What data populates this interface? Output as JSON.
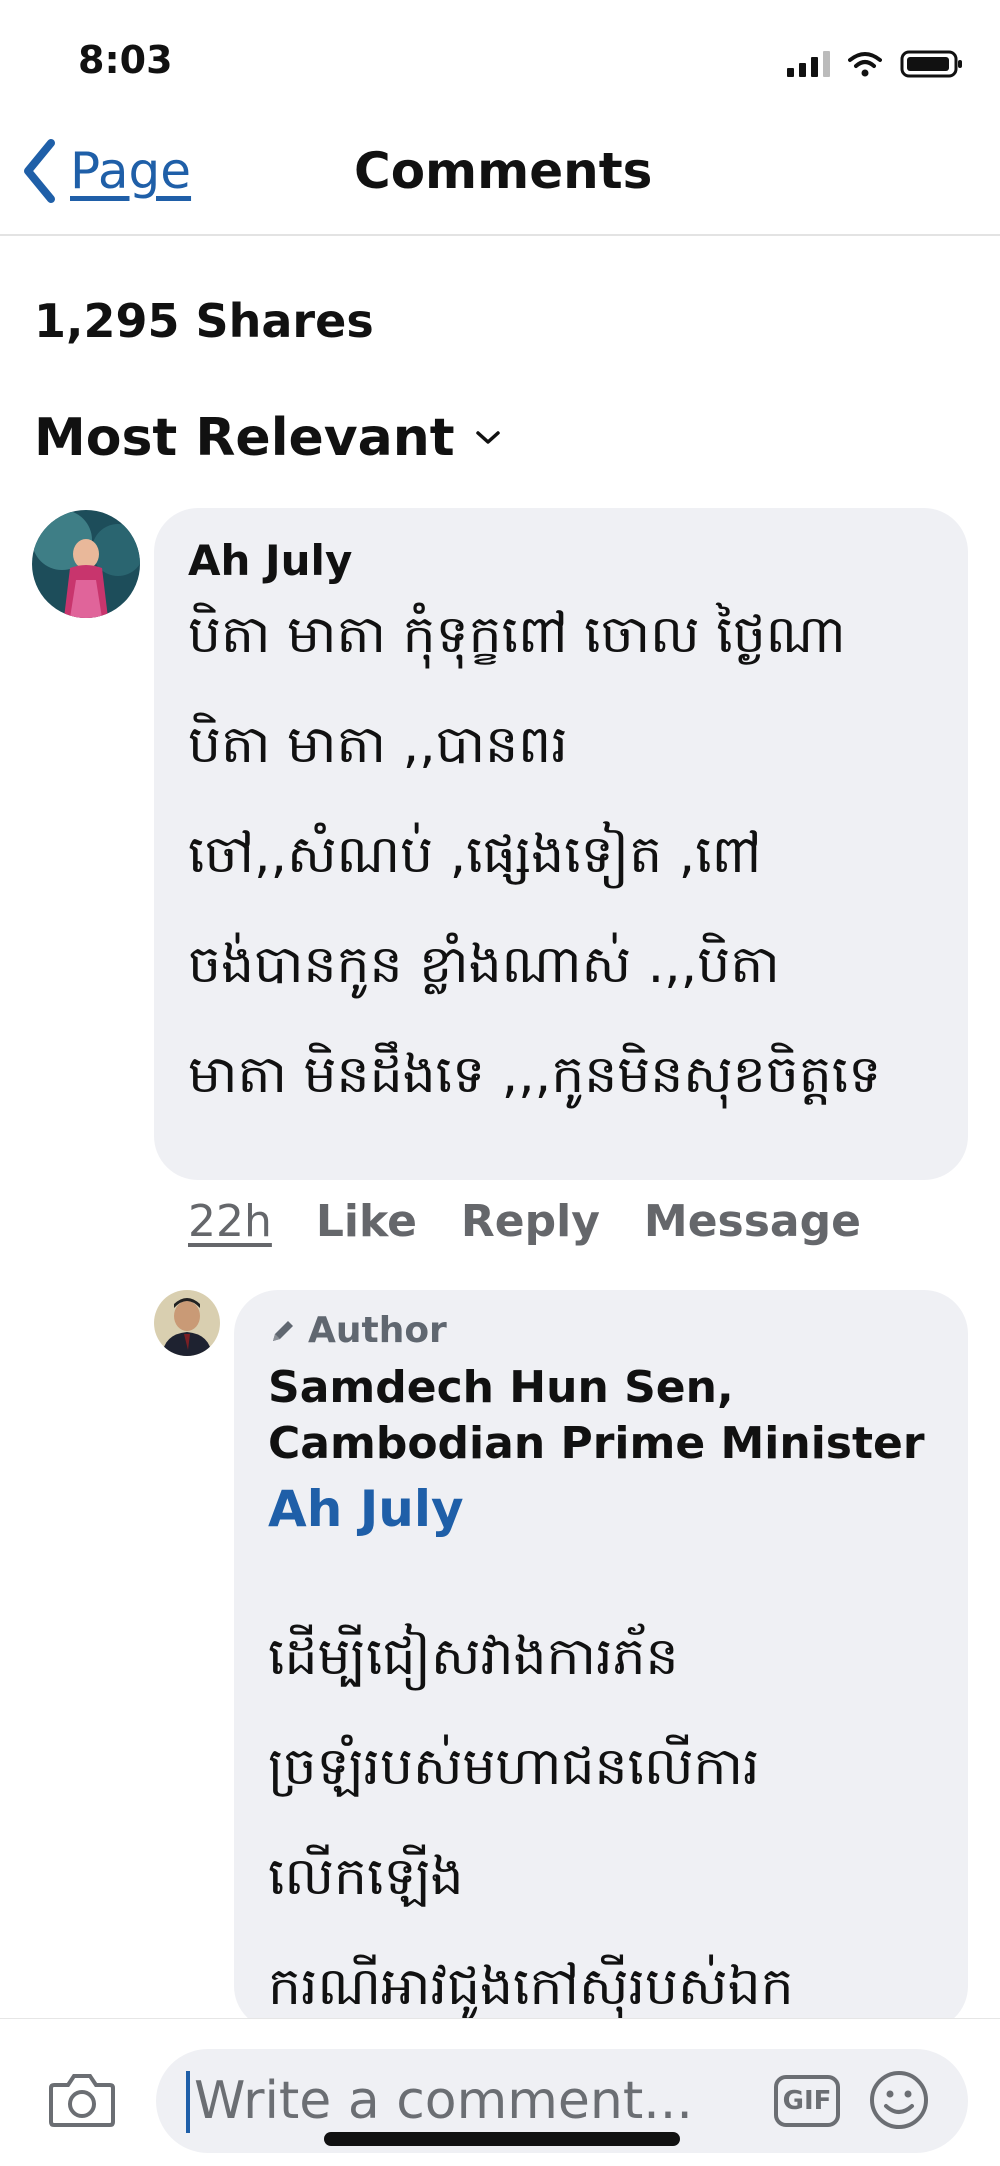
{
  "status_bar": {
    "time": "8:03"
  },
  "nav": {
    "back_label": "Page",
    "title": "Comments"
  },
  "post": {
    "shares": "1,295 Shares"
  },
  "sort": {
    "label": "Most Relevant"
  },
  "comment": {
    "name": "Ah July",
    "lines": [
      "បិតា មាតា កុំទុក្ខពៅ ចោល ថ្ងៃណា",
      "បិតា មាតា ,,បានពរ",
      "ចៅ,,សំណប់ ,ផ្សេងទៀត ,ពៅ",
      "ចង់បានកូន ខ្លាំងណាស់ .,,បិតា",
      "មាតា មិនដឹងទេ ,,,កូនមិនសុខចិត្តទេ"
    ],
    "time": "22h",
    "like": "Like",
    "reply": "Reply",
    "message": "Message"
  },
  "reply": {
    "badge": "Author",
    "name_lines": [
      "Samdech Hun Sen,",
      "Cambodian Prime Minister"
    ],
    "mention": "Ah July",
    "lines": [
      "ដើម្បីជៀសវាងការភ័ន",
      "ច្រឡំរបស់មហាជនលើការ",
      "លើកឡើង",
      "ករណីអាវជូងកៅស៊ីរបស់ឯក"
    ]
  },
  "composer": {
    "placeholder": "Write a comment...",
    "gif_label": "GIF"
  },
  "colors": {
    "link_blue": "#1f5fa8",
    "bubble": "#eff0f4",
    "muted": "#65676b"
  }
}
